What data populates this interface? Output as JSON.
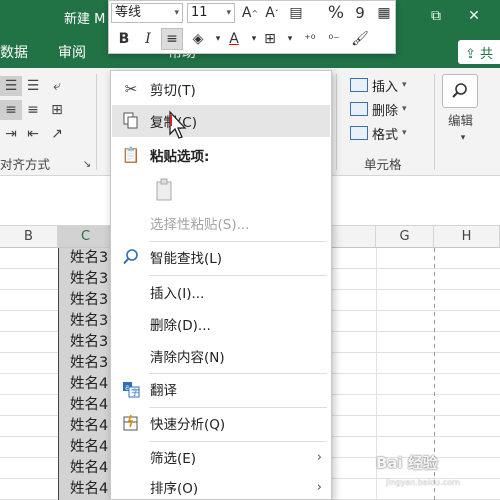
{
  "window": {
    "title": "新建 M",
    "restore_icon": "⧉",
    "close_icon": "✕",
    "accent": "#217346"
  },
  "tabs": [
    "数据",
    "审阅",
    "帮助"
  ],
  "share_label": "⇪ 共",
  "ribbon": {
    "groups": {
      "alignment": "对齐方式",
      "cells": "单元格",
      "editing": "编辑"
    },
    "cells_commands": [
      "插入",
      "删除",
      "格式"
    ],
    "editing_icon": "search-icon"
  },
  "mini_toolbar": {
    "font_name": "等线",
    "font_size": "11",
    "bold": "B",
    "italic": "I",
    "font_color": "A",
    "percent": "%",
    "comma": "9"
  },
  "context_menu": {
    "items": [
      {
        "label": "剪切(T)",
        "icon": "scissors-icon"
      },
      {
        "label": "复制(C)",
        "icon": "copy-icon",
        "highlighted": true
      },
      {
        "label": "粘贴选项:",
        "icon": "clipboard-icon",
        "bold": true
      },
      {
        "label": "选择性粘贴(S)...",
        "disabled": true
      },
      {
        "label": "智能查找(L)",
        "icon": "smart-lookup-icon"
      },
      {
        "label": "插入(I)..."
      },
      {
        "label": "删除(D)..."
      },
      {
        "label": "清除内容(N)"
      },
      {
        "label": "翻译",
        "icon": "translate-icon"
      },
      {
        "label": "快速分析(Q)",
        "icon": "quick-analysis-icon"
      },
      {
        "label": "筛选(E)",
        "submenu": true
      },
      {
        "label": "排序(O)",
        "submenu": true
      }
    ],
    "submenu_arrow": "›"
  },
  "grid": {
    "columns": [
      "B",
      "C",
      "G",
      "H"
    ],
    "selected_column": "C",
    "cells": [
      "姓名3",
      "姓名3",
      "姓名3",
      "姓名3",
      "姓名3",
      "姓名3",
      "姓名4",
      "姓名4",
      "姓名4",
      "姓名4",
      "姓名4",
      "姓名4"
    ]
  },
  "watermark": {
    "brand": "Bai 经验",
    "url": "jingyan.baidu.com"
  }
}
